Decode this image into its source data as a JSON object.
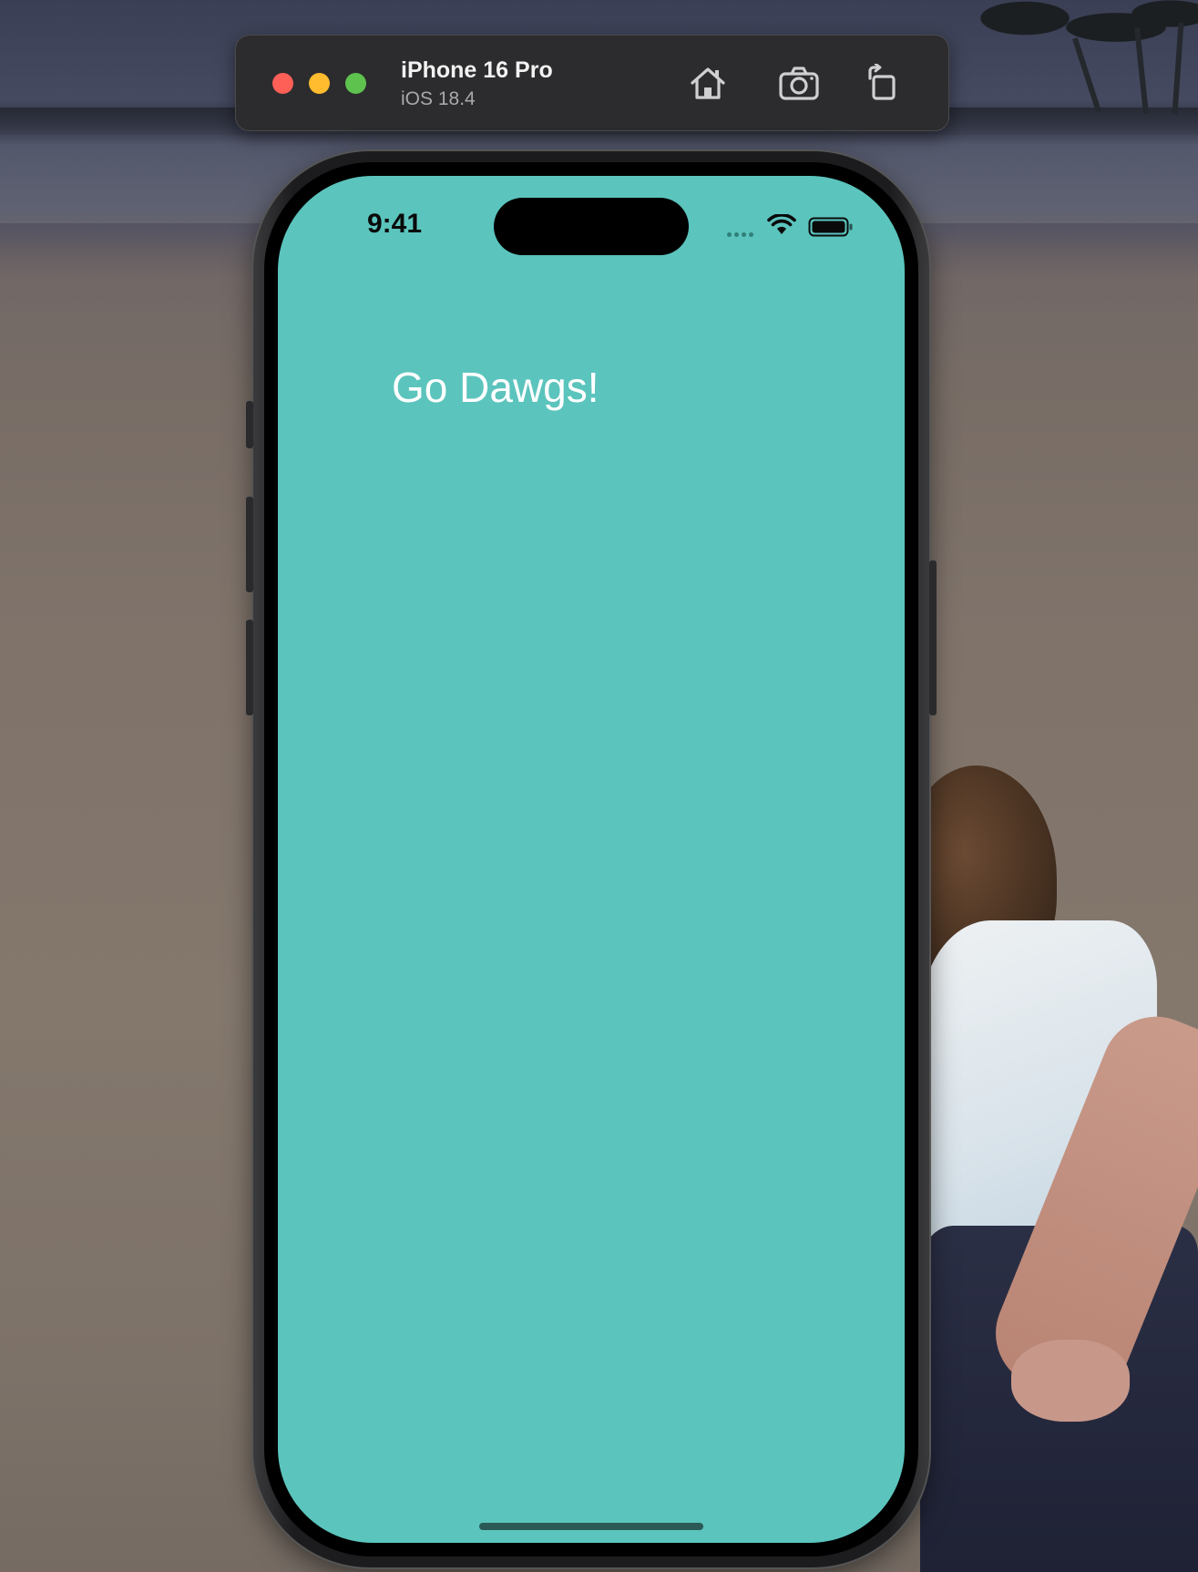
{
  "simulator": {
    "device_name": "iPhone 16 Pro",
    "os_version": "iOS 18.4",
    "toolbar": {
      "home_icon": "home-icon",
      "screenshot_icon": "camera-icon",
      "rotate_icon": "rotate-icon"
    },
    "traffic_lights": {
      "close_color": "#fe5f57",
      "minimize_color": "#febc2e",
      "zoom_color": "#5ec24e"
    }
  },
  "status_bar": {
    "time": "9:41",
    "wifi_icon": "wifi-icon",
    "battery_icon": "battery-icon"
  },
  "app": {
    "background_color": "#5bc4bd",
    "greeting": "Go Dawgs!"
  }
}
